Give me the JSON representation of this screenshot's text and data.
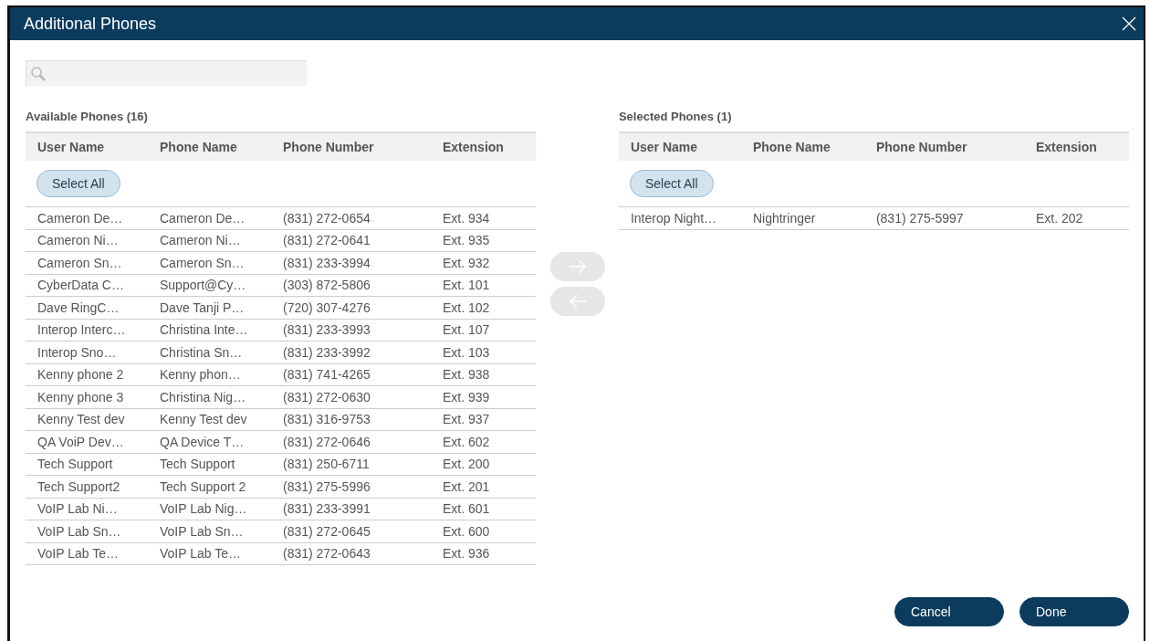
{
  "window": {
    "title": "Additional Phones"
  },
  "available": {
    "title": "Available Phones (16)",
    "columns": [
      "User Name",
      "Phone Name",
      "Phone Number",
      "Extension"
    ],
    "select_all": "Select All",
    "rows": [
      [
        "Cameron De…",
        "Cameron De…",
        "(831) 272-0654",
        "Ext. 934"
      ],
      [
        "Cameron Ni…",
        "Cameron Ni…",
        "(831) 272-0641",
        "Ext. 935"
      ],
      [
        "Cameron Sn…",
        "Cameron Sn…",
        "(831) 233-3994",
        "Ext. 932"
      ],
      [
        "CyberData C…",
        "Support@Cy…",
        "(303) 872-5806",
        "Ext. 101"
      ],
      [
        "Dave RingC…",
        "Dave Tanji P…",
        "(720) 307-4276",
        "Ext. 102"
      ],
      [
        "Interop Interc…",
        "Christina Inte…",
        "(831) 233-3993",
        "Ext. 107"
      ],
      [
        "Interop Sno…",
        "Christina Sn…",
        "(831) 233-3992",
        "Ext. 103"
      ],
      [
        "Kenny phone 2",
        "Kenny phon…",
        "(831) 741-4265",
        "Ext. 938"
      ],
      [
        "Kenny phone 3",
        "Christina Nig…",
        "(831) 272-0630",
        "Ext. 939"
      ],
      [
        "Kenny Test dev",
        "Kenny Test dev",
        "(831) 316-9753",
        "Ext. 937"
      ],
      [
        "QA VoiP Dev…",
        "QA Device T…",
        "(831) 272-0646",
        "Ext. 602"
      ],
      [
        "Tech Support",
        "Tech Support",
        "(831) 250-6711",
        "Ext. 200"
      ],
      [
        "Tech Support2",
        "Tech Support 2",
        "(831) 275-5996",
        "Ext. 201"
      ],
      [
        "VoIP Lab Ni…",
        "VoIP Lab Nig…",
        "(831) 233-3991",
        "Ext. 601"
      ],
      [
        "VoIP Lab Sn…",
        "VoIP Lab Sn…",
        "(831) 272-0645",
        "Ext. 600"
      ],
      [
        "VoIP Lab Te…",
        "VoIP Lab Te…",
        "(831) 272-0643",
        "Ext. 936"
      ]
    ]
  },
  "move_buttons": [
    {
      "kind": "right",
      "disabled": true
    },
    {
      "kind": "left",
      "disabled": true
    }
  ],
  "selected": {
    "title": "Selected Phones (1)",
    "columns": [
      "User Name",
      "Phone Name",
      "Phone Number",
      "Extension"
    ],
    "select_all": "Select All",
    "rows": [
      [
        "Interop Night…",
        "Nightringer",
        "(831) 275-5997",
        "Ext. 202"
      ]
    ]
  },
  "buttons": [
    "Cancel",
    "Done"
  ]
}
